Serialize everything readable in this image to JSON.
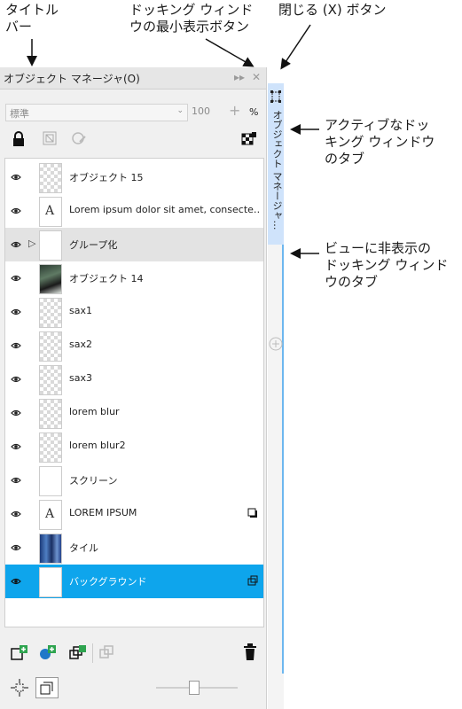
{
  "callouts": {
    "title_bar": [
      "タイトル",
      "バー"
    ],
    "minimize": [
      "ドッキング ウィンド",
      "ウの最小表示ボタン"
    ],
    "close": [
      "閉じる (X) ボタン"
    ],
    "active_tab": [
      "アクティブなドッ",
      "キング ウィンドウ",
      "のタブ"
    ],
    "hidden_tab": [
      "ビューに非表示の",
      "ドッキング ウィンド",
      "ウのタブ"
    ]
  },
  "panel": {
    "title": "オブジェクト マネージャ(O)",
    "minimize_glyph": "▸▸",
    "close_glyph": "✕",
    "blend_mode": "標準",
    "opacity": "100",
    "opacity_unit": "%",
    "tab_label": "オブジェクト マネージャ…"
  },
  "layers": [
    {
      "name": "オブジェクト 15",
      "thumb": "checker"
    },
    {
      "name": "Lorem ipsum dolor sit amet, consecte…",
      "thumb": "text"
    },
    {
      "name": "グループ化",
      "thumb": "blank",
      "group": true
    },
    {
      "name": "オブジェクト 14",
      "thumb": "photo"
    },
    {
      "name": "sax1",
      "thumb": "checker"
    },
    {
      "name": "sax2",
      "thumb": "checker"
    },
    {
      "name": "sax3",
      "thumb": "checker"
    },
    {
      "name": "lorem blur",
      "thumb": "checker"
    },
    {
      "name": "lorem blur2",
      "thumb": "checker"
    },
    {
      "name": "スクリーン",
      "thumb": "blank"
    },
    {
      "name": "LOREM IPSUM",
      "thumb": "text",
      "badge": "shadow"
    },
    {
      "name": "タイル",
      "thumb": "tile"
    },
    {
      "name": "バックグラウンド",
      "thumb": "blank",
      "selected": true,
      "badge": "lock"
    }
  ],
  "colors": {
    "selected": "#0ea5ec",
    "active_tab": "#cfe3fb",
    "tab_line": "#6db7ef"
  }
}
